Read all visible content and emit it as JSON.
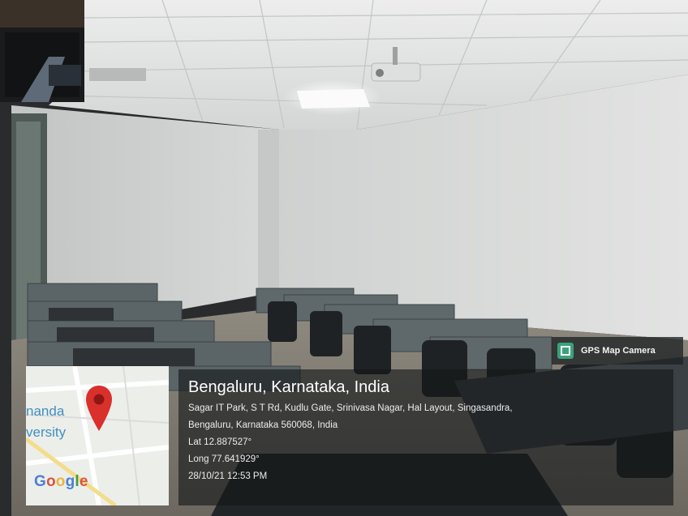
{
  "badge": {
    "label": "GPS Map Camera",
    "icon": "gps-map-camera-icon"
  },
  "map": {
    "label_line1": "nanda",
    "label_line2": "versity",
    "provider": [
      "G",
      "o",
      "o",
      "g",
      "l",
      "e"
    ],
    "pin_icon": "map-pin-icon",
    "pin_color": "#d9302c"
  },
  "location": {
    "title": "Bengaluru, Karnataka, India",
    "address_line1": "Sagar IT Park, S T Rd, Kudlu Gate, Srinivasa Nagar, Hal Layout, Singasandra,",
    "address_line2": "Bengaluru, Karnataka 560068, India",
    "latitude": "Lat 12.887527°",
    "longitude": "Long 77.641929°",
    "timestamp": "28/10/21 12:53 PM"
  }
}
